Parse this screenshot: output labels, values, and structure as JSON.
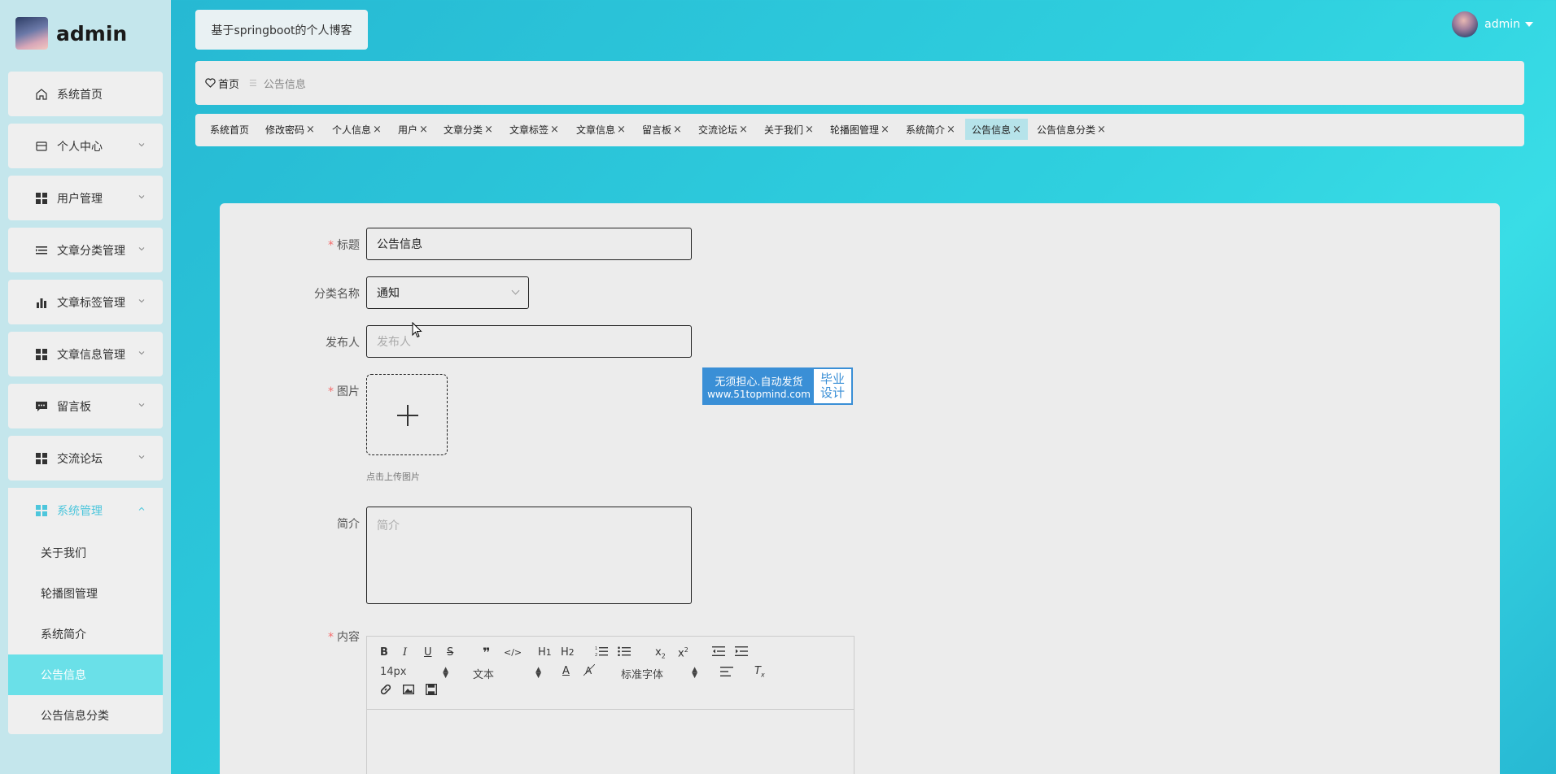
{
  "sidebar": {
    "user_name": "admin",
    "menu": [
      {
        "label": "系统首页",
        "icon": "home-icon"
      },
      {
        "label": "个人中心",
        "icon": "id-card-icon"
      },
      {
        "label": "用户管理",
        "icon": "grid-icon"
      },
      {
        "label": "文章分类管理",
        "icon": "list-icon"
      },
      {
        "label": "文章标签管理",
        "icon": "bar-chart-icon"
      },
      {
        "label": "文章信息管理",
        "icon": "grid-icon"
      },
      {
        "label": "留言板",
        "icon": "chat-icon"
      },
      {
        "label": "交流论坛",
        "icon": "grid-icon"
      },
      {
        "label": "系统管理",
        "icon": "grid-icon"
      }
    ],
    "submenu": [
      "关于我们",
      "轮播图管理",
      "系统简介",
      "公告信息",
      "公告信息分类"
    ]
  },
  "header": {
    "site_title": "基于springboot的个人博客",
    "user_name": "admin"
  },
  "breadcrumb": {
    "home": "首页",
    "current": "公告信息"
  },
  "tags": [
    {
      "label": "系统首页",
      "closable": false
    },
    {
      "label": "修改密码",
      "closable": true
    },
    {
      "label": "个人信息",
      "closable": true
    },
    {
      "label": "用户",
      "closable": true
    },
    {
      "label": "文章分类",
      "closable": true
    },
    {
      "label": "文章标签",
      "closable": true
    },
    {
      "label": "文章信息",
      "closable": true
    },
    {
      "label": "留言板",
      "closable": true
    },
    {
      "label": "交流论坛",
      "closable": true
    },
    {
      "label": "关于我们",
      "closable": true
    },
    {
      "label": "轮播图管理",
      "closable": true
    },
    {
      "label": "系统简介",
      "closable": true
    },
    {
      "label": "公告信息",
      "closable": true,
      "active": true
    },
    {
      "label": "公告信息分类",
      "closable": true
    }
  ],
  "form": {
    "title_label": "标题",
    "title_value": "公告信息",
    "category_label": "分类名称",
    "category_value": "通知",
    "publisher_label": "发布人",
    "publisher_placeholder": "发布人",
    "image_label": "图片",
    "upload_hint": "点击上传图片",
    "intro_label": "简介",
    "intro_placeholder": "简介",
    "content_label": "内容",
    "required_mark": "*"
  },
  "editor": {
    "font_size": "14px",
    "header_select": "文本",
    "font_family": "标准字体"
  },
  "watermark": {
    "line1": "无须担心.自动发货",
    "line2": "www.51topmind.com",
    "right1": "毕业",
    "right2": "设计"
  },
  "colors": {
    "accent": "#4dc6dc",
    "active_submenu": "#6ae0e8",
    "required": "#f56c6c",
    "watermark_blue": "#3a8fd6"
  }
}
